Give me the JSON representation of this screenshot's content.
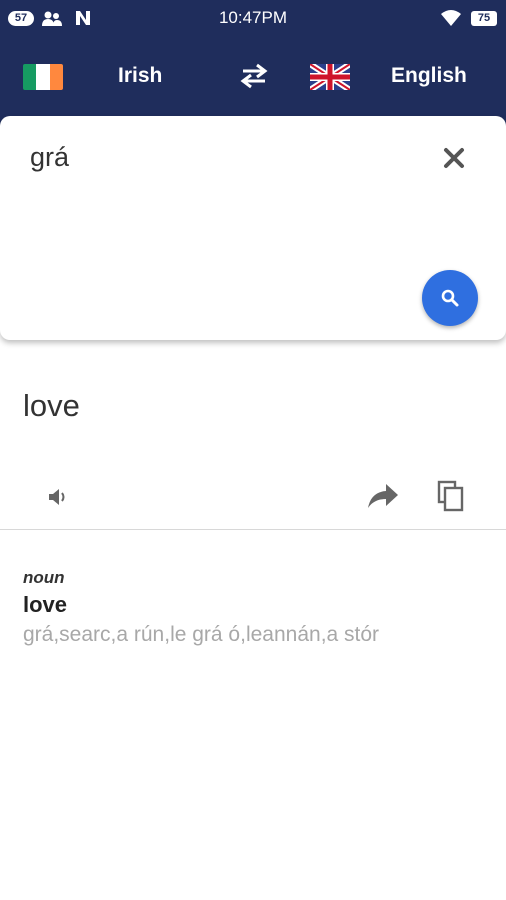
{
  "status_bar": {
    "notif_count": "57",
    "time": "10:47PM",
    "battery": "75"
  },
  "language_bar": {
    "source_language": "Irish",
    "target_language": "English",
    "swap_icon": "swap-arrows-icon",
    "source_flag": "ireland-flag",
    "target_flag": "uk-flag"
  },
  "input_card": {
    "text": "grá",
    "clear_icon": "close-icon",
    "search_icon": "search-icon",
    "accent_color": "#2f6fe0"
  },
  "translation": {
    "text": "love",
    "speaker_icon": "speaker-icon",
    "share_icon": "share-icon",
    "copy_icon": "copy-icon"
  },
  "dictionary": {
    "part_of_speech": "noun",
    "word": "love",
    "synonyms": "grá,searc,a rún,le grá ó,leannán,a stór"
  },
  "colors": {
    "header_bg": "#1f2d5c",
    "flag_green": "#169b62",
    "flag_white": "#ffffff",
    "flag_orange": "#ff883e"
  }
}
